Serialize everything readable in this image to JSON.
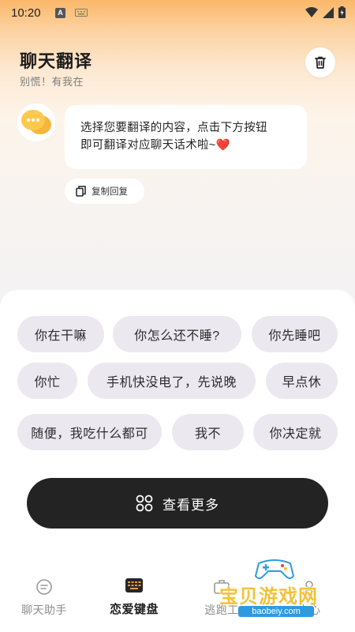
{
  "status_bar": {
    "time": "10:20",
    "notification_letter": "A"
  },
  "header": {
    "title": "聊天翻译",
    "subtitle": "别慌！有我在"
  },
  "message": {
    "line1": "选择您要翻译的内容，点击下方按钮",
    "line2": "即可翻译对应聊天话术啦~",
    "heart": "❤️",
    "copy_label": "复制回复"
  },
  "phrases": [
    "你在干嘛",
    "你怎么还不睡?",
    "你先睡吧",
    "你忙",
    "手机快没电了，先说晚",
    "早点休",
    "随便，我吃什么都可",
    "我不",
    "你决定就"
  ],
  "more_button": {
    "label": "查看更多"
  },
  "tabs": [
    {
      "label": "聊天助手"
    },
    {
      "label": "恋爱键盘"
    },
    {
      "label": "逃跑工"
    },
    {
      "label": "中心"
    }
  ],
  "watermark": {
    "text": "宝贝游戏网",
    "url": "baobeiy.com"
  },
  "colors": {
    "accent_orange": "#fbb769",
    "chip_bg": "#ebe8f0",
    "dark_button": "#232323"
  }
}
